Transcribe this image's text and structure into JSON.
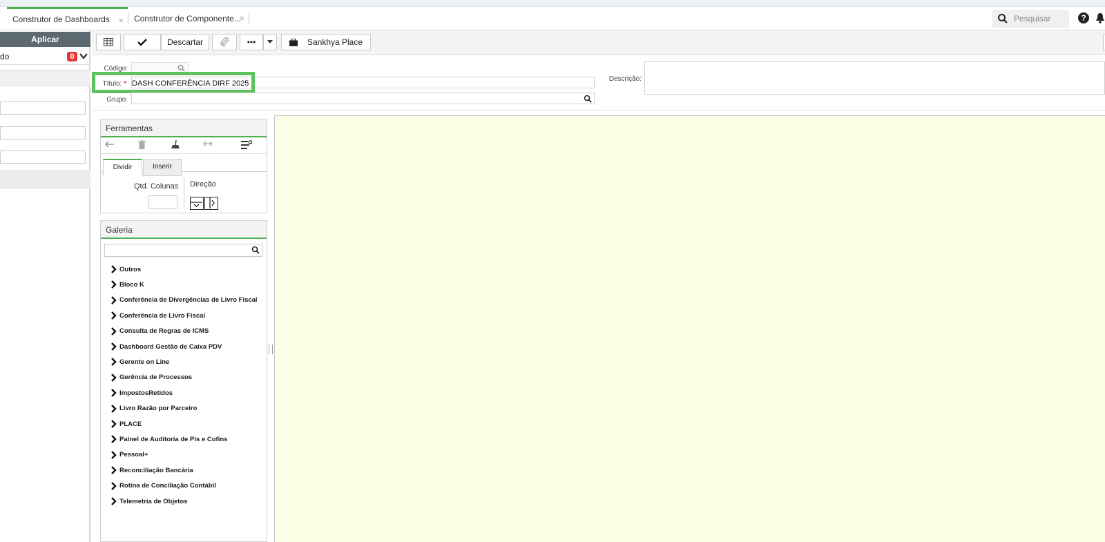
{
  "tabs": [
    {
      "label": "Construtor de Dashboards",
      "close": "×"
    },
    {
      "label": "Construtor de Componente...",
      "close": "×"
    }
  ],
  "header": {
    "search_placeholder": "Pesquisar",
    "help_icon": "?",
    "icons": [
      "search-icon",
      "help-icon",
      "bell-icon"
    ]
  },
  "left_panel": {
    "apply_label": "Aplicar",
    "filter_text": "do",
    "badge_count": "0"
  },
  "toolbar": {
    "discard_label": "Descartar",
    "more_label": "•••",
    "place_label": "Sankhya Place"
  },
  "form": {
    "codigo_label": "Código:",
    "titulo_label": "Título:",
    "titulo_required": "*",
    "titulo_value": "DASH CONFERÊNCIA DIRF 2025",
    "grupo_label": "Grupo:",
    "descricao_label": "Descrição:"
  },
  "tools_panel": {
    "title": "Ferramentas",
    "tabs": [
      "Dividir",
      "Inserir"
    ],
    "qtd_label": "Qtd. Colunas",
    "direction_label": "Direção"
  },
  "gallery": {
    "title": "Galeria",
    "items": [
      "Outros",
      "Bloco K",
      "Conferência de Divergências de Livro Fiscal",
      "Conferência de Livro Fiscal",
      "Consulta de Regras de ICMS",
      "Dashboard Gestão de Caixa PDV",
      "Gerente on Line",
      "Gerência de Processos",
      "ImpostosRetidos",
      "Livro Razão por Parceiro",
      "PLACE",
      "Painel de Auditoria de Pis e Cofins",
      "Pessoal+",
      "Reconciliação Bancária",
      "Rotina de Conciliação Contábil",
      "Telemetria de Objetos"
    ]
  },
  "colors": {
    "accent": "#4caf50",
    "highlight": "#5fc15f",
    "badge": "#e53935",
    "canvas": "#fcfee6"
  }
}
